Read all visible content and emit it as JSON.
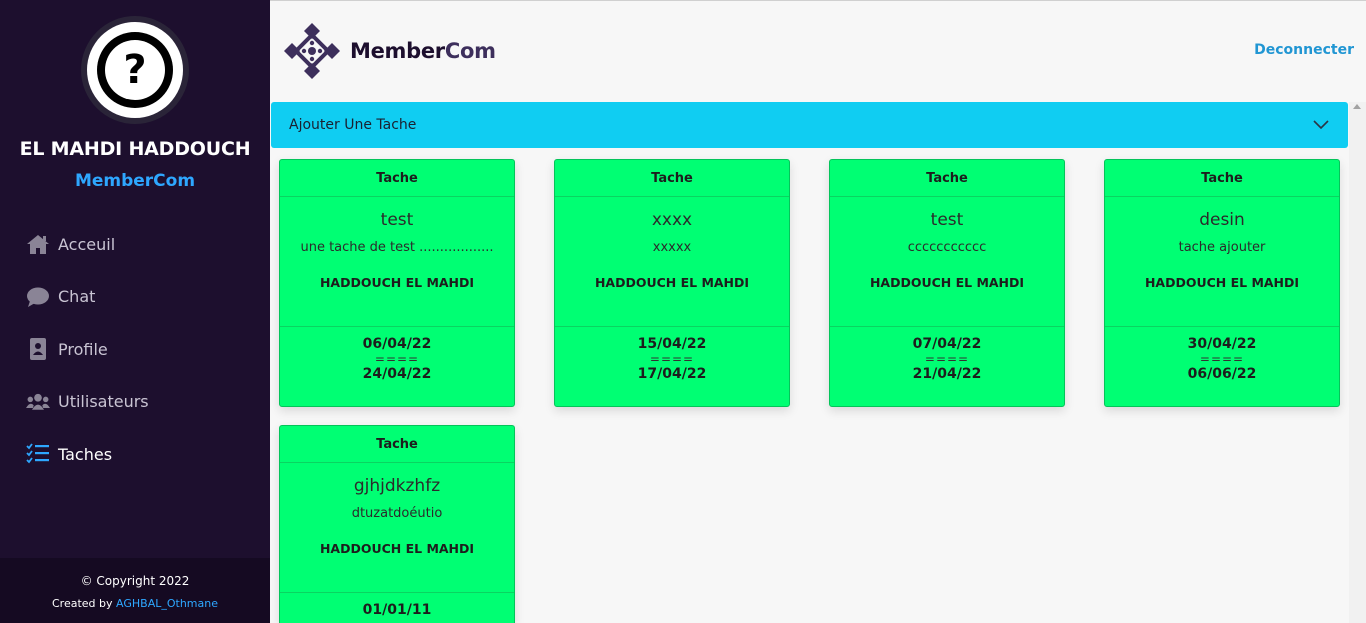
{
  "sidebar": {
    "user_name": "EL MAHDI HADDOUCH",
    "brand": "MemberCom",
    "items": [
      {
        "label": "Acceuil",
        "icon": "home-icon"
      },
      {
        "label": "Chat",
        "icon": "chat-icon"
      },
      {
        "label": "Profile",
        "icon": "id-badge-icon"
      },
      {
        "label": "Utilisateurs",
        "icon": "users-icon"
      },
      {
        "label": "Taches",
        "icon": "tasks-icon",
        "active": true
      }
    ],
    "footer": {
      "copyright": "© Copyright 2022",
      "created_prefix": "Created by ",
      "created_link": "AGHBAL_Othmane"
    }
  },
  "header": {
    "logo_text_main": "Member",
    "logo_text_accent": "Com",
    "logout": "Deconnecter"
  },
  "accordion": {
    "label": "Ajouter Une Tache"
  },
  "tasks": [
    {
      "header": "Tache",
      "title": "test",
      "description": "une tache de test ..................",
      "owner": "HADDOUCH EL MAHDI",
      "start": "06/04/22",
      "separator": "====",
      "end": "24/04/22"
    },
    {
      "header": "Tache",
      "title": "xxxx",
      "description": "xxxxx",
      "owner": "HADDOUCH EL MAHDI",
      "start": "15/04/22",
      "separator": "====",
      "end": "17/04/22"
    },
    {
      "header": "Tache",
      "title": "test",
      "description": "ccccccccccc",
      "owner": "HADDOUCH EL MAHDI",
      "start": "07/04/22",
      "separator": "====",
      "end": "21/04/22"
    },
    {
      "header": "Tache",
      "title": "desin",
      "description": "tache ajouter",
      "owner": "HADDOUCH EL MAHDI",
      "start": "30/04/22",
      "separator": "====",
      "end": "06/06/22"
    },
    {
      "header": "Tache",
      "title": "gjhjdkzhfz",
      "description": "dtuzatdoéutio",
      "owner": "HADDOUCH EL MAHDI",
      "start": "01/01/11",
      "separator": "====",
      "end": ""
    }
  ],
  "colors": {
    "sidebar_bg": "#1d0f2e",
    "accent_blue": "#2ea7ff",
    "accordion_bg": "#10cdf2",
    "card_bg": "#00ff73"
  }
}
